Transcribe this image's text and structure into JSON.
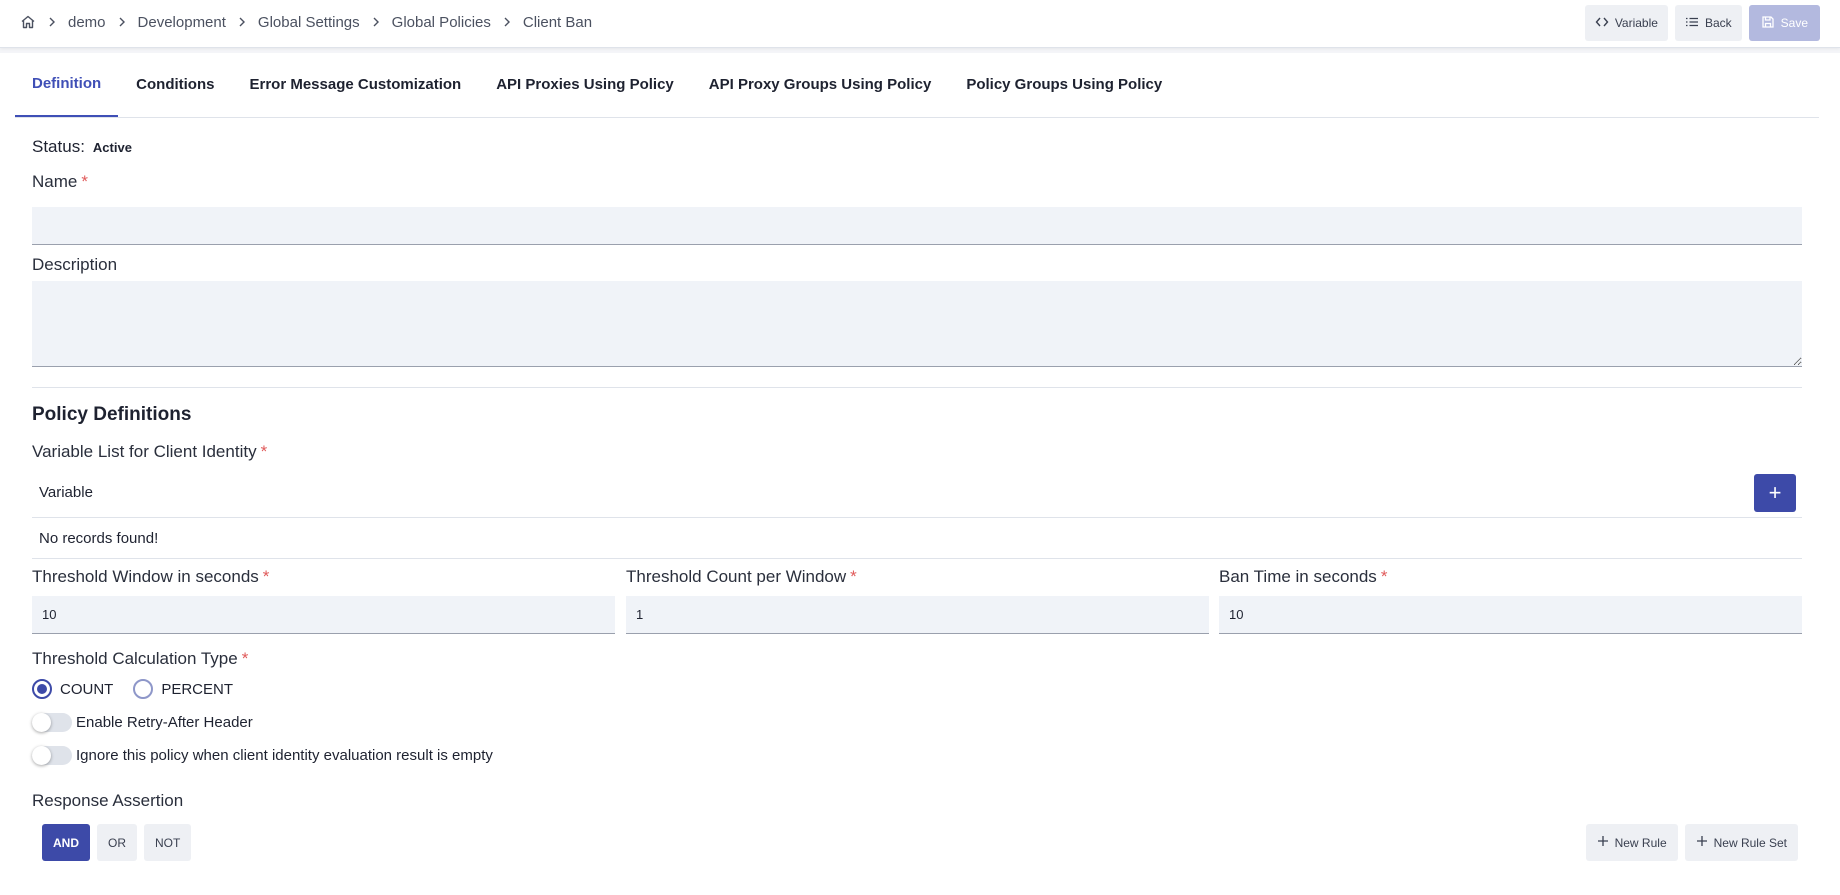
{
  "breadcrumb": [
    "demo",
    "Development",
    "Global Settings",
    "Global Policies",
    "Client Ban"
  ],
  "toolbar": {
    "variable_label": "Variable",
    "back_label": "Back",
    "save_label": "Save"
  },
  "tabs": [
    {
      "label": "Definition",
      "active": true
    },
    {
      "label": "Conditions"
    },
    {
      "label": "Error Message Customization"
    },
    {
      "label": "API Proxies Using Policy"
    },
    {
      "label": "API Proxy Groups Using Policy"
    },
    {
      "label": "Policy Groups Using Policy"
    }
  ],
  "form": {
    "status_label": "Status:",
    "status_value": "Active",
    "name_label": "Name",
    "name_value": "",
    "description_label": "Description",
    "description_value": "",
    "required_mark": "*"
  },
  "policy": {
    "section_title": "Policy Definitions",
    "variable_list_label": "Variable List for Client Identity",
    "table_header": "Variable",
    "add_label": "+",
    "empty_text": "No records found!",
    "threshold_window_label": "Threshold Window in seconds",
    "threshold_window_value": "10",
    "threshold_count_label": "Threshold Count per Window",
    "threshold_count_value": "1",
    "ban_time_label": "Ban Time in seconds",
    "ban_time_value": "10",
    "calc_type_label": "Threshold Calculation Type",
    "calc_options": [
      "COUNT",
      "PERCENT"
    ],
    "calc_selected": "COUNT",
    "retry_after_label": "Enable Retry-After Header",
    "retry_after_on": false,
    "ignore_empty_label": "Ignore this policy when client identity evaluation result is empty",
    "ignore_empty_on": false
  },
  "assertion": {
    "label": "Response Assertion",
    "operators": [
      "AND",
      "OR",
      "NOT"
    ],
    "selected": "AND",
    "new_rule_label": "New Rule",
    "new_rule_set_label": "New Rule Set"
  },
  "colors": {
    "accent": "#3d4aa8",
    "required": "#e05a5a",
    "save_disabled": "#b3b9df"
  }
}
